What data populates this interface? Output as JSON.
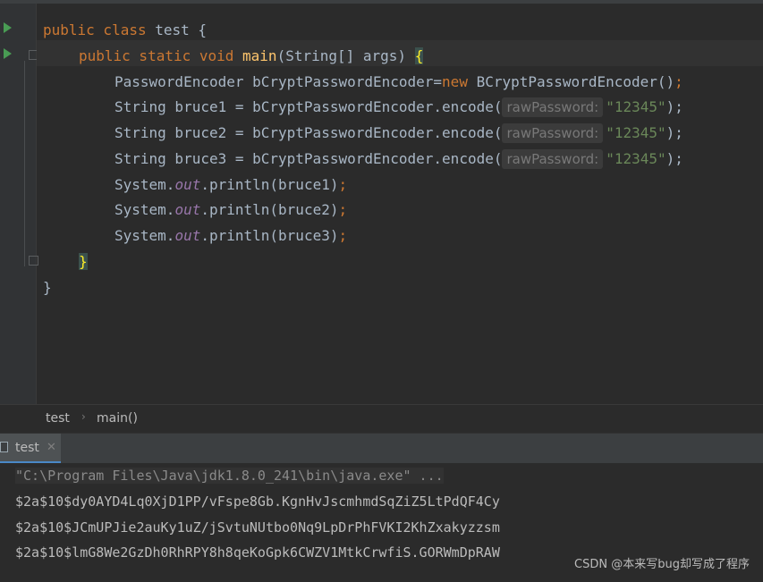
{
  "editor": {
    "lines": [
      {
        "kw": "public class ",
        "name": "test",
        "rest": " {"
      },
      {
        "kw": "public static void ",
        "fn": "main",
        "rest": "(String[] args) ",
        "brace": "{"
      },
      {
        "type": "PasswordEncoder bCryptPasswordEncoder=",
        "kw": "new",
        "rest": " BCryptPasswordEncoder()",
        "semi": ";"
      },
      {
        "code": "String bruce1 = bCryptPasswordEncoder.encode(",
        "hint": "rawPassword:",
        "str": "\"12345\"",
        "tail": ");"
      },
      {
        "code": "String bruce2 = bCryptPasswordEncoder.encode(",
        "hint": "rawPassword:",
        "str": "\"12345\"",
        "tail": ");"
      },
      {
        "code": "String bruce3 = bCryptPasswordEncoder.encode(",
        "hint": "rawPassword:",
        "str": "\"12345\"",
        "tail": ");"
      },
      {
        "pre": "System.",
        "fld": "out",
        "post": ".println(bruce1)",
        "semi": ";"
      },
      {
        "pre": "System.",
        "fld": "out",
        "post": ".println(bruce2)",
        "semi": ";"
      },
      {
        "pre": "System.",
        "fld": "out",
        "post": ".println(bruce3)",
        "semi": ";"
      },
      {
        "brace": "}"
      },
      {
        "brace": "}"
      }
    ]
  },
  "breadcrumbs": [
    "test",
    "main()"
  ],
  "breadcrumb_sep": "›",
  "run_panel": {
    "tab_label": "test",
    "close_glyph": "✕",
    "command": "\"C:\\Program Files\\Java\\jdk1.8.0_241\\bin\\java.exe\" ...",
    "output": [
      "$2a$10$dy0AYD4Lq0XjD1PP/vFspe8Gb.KgnHvJscmhmdSqZiZ5LtPdQF4Cy",
      "$2a$10$JCmUPJie2auKy1uZ/jSvtuNUtbo0Nq9LpDrPhFVKI2KhZxakyzzsm",
      "$2a$10$lmG8We2GzDh0RhRPY8h8qeKoGpk6CWZV1MtkCrwfiS.GORWmDpRAW"
    ]
  },
  "watermark": "CSDN @本来写bug却写成了程序"
}
